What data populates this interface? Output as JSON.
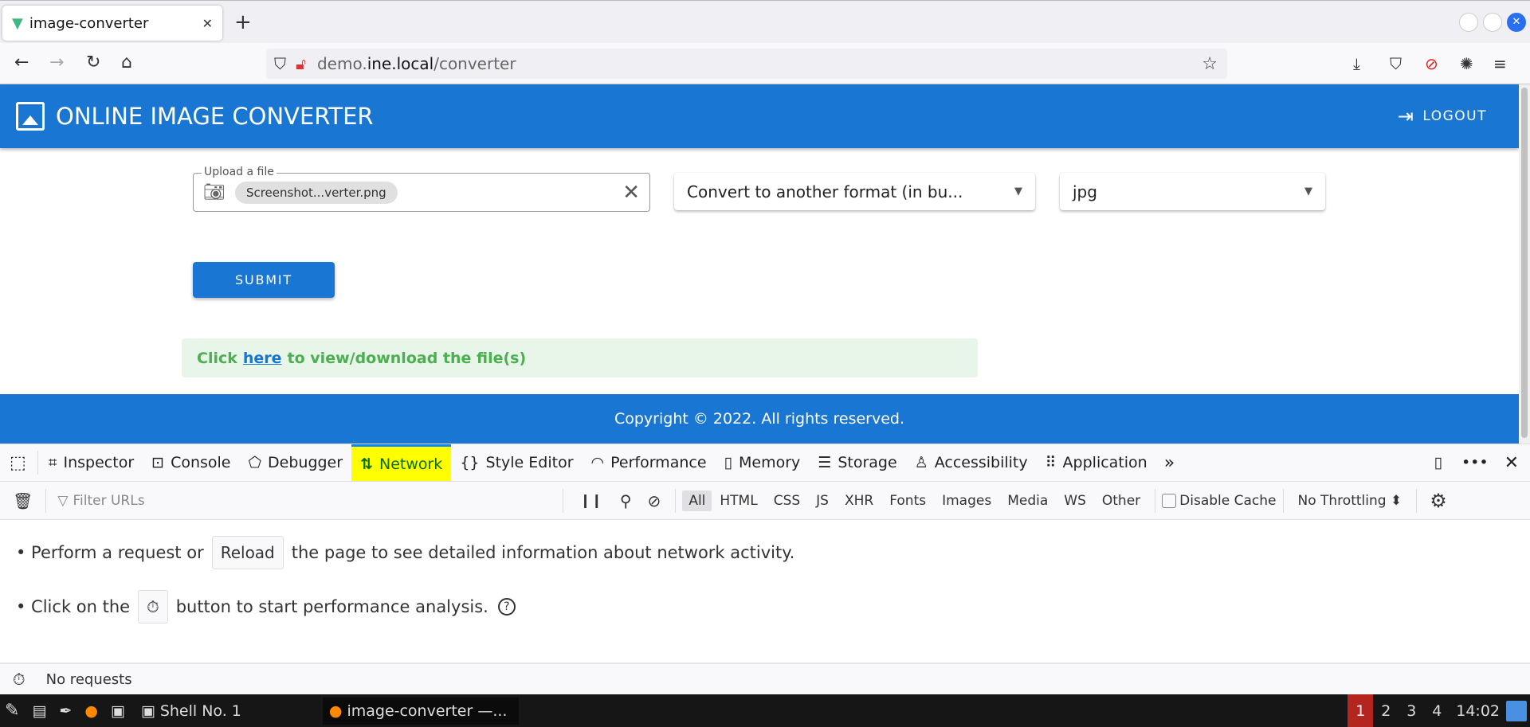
{
  "browser": {
    "tab_title": "image-converter",
    "new_tab": "+",
    "url_prefix": "demo.",
    "url_domain": "ine.local",
    "url_path": "/converter"
  },
  "app": {
    "title": "ONLINE IMAGE CONVERTER",
    "logout": "LOGOUT",
    "brand_color": "#1976d2"
  },
  "form": {
    "upload_label": "Upload a file",
    "file_chip": "Screenshot...verter.png",
    "mode_select": "Convert to another format (in bu...",
    "format_select": "jpg",
    "submit": "SUBMIT"
  },
  "alert": {
    "prefix": "Click",
    "link": "here",
    "suffix": "to view/download the file(s)"
  },
  "footer": {
    "text": "Copyright © 2022. All rights reserved."
  },
  "devtools": {
    "tabs": [
      "Inspector",
      "Console",
      "Debugger",
      "Network",
      "Style Editor",
      "Performance",
      "Memory",
      "Storage",
      "Accessibility",
      "Application"
    ],
    "active_tab": "Network",
    "filter_placeholder": "Filter URLs",
    "filters": [
      "All",
      "HTML",
      "CSS",
      "JS",
      "XHR",
      "Fonts",
      "Images",
      "Media",
      "WS",
      "Other"
    ],
    "disable_cache": "Disable Cache",
    "throttling": "No Throttling",
    "msg1_a": "• Perform a request or",
    "reload": "Reload",
    "msg1_b": "the page to see detailed information about network activity.",
    "msg2_a": "• Click on the",
    "msg2_b": "button to start performance analysis.",
    "status": "No requests"
  },
  "taskbar": {
    "shell": "Shell No. 1",
    "window": "image-converter —...",
    "workspaces": [
      "1",
      "2",
      "3",
      "4"
    ],
    "active_workspace": "1",
    "clock": "14:02"
  }
}
